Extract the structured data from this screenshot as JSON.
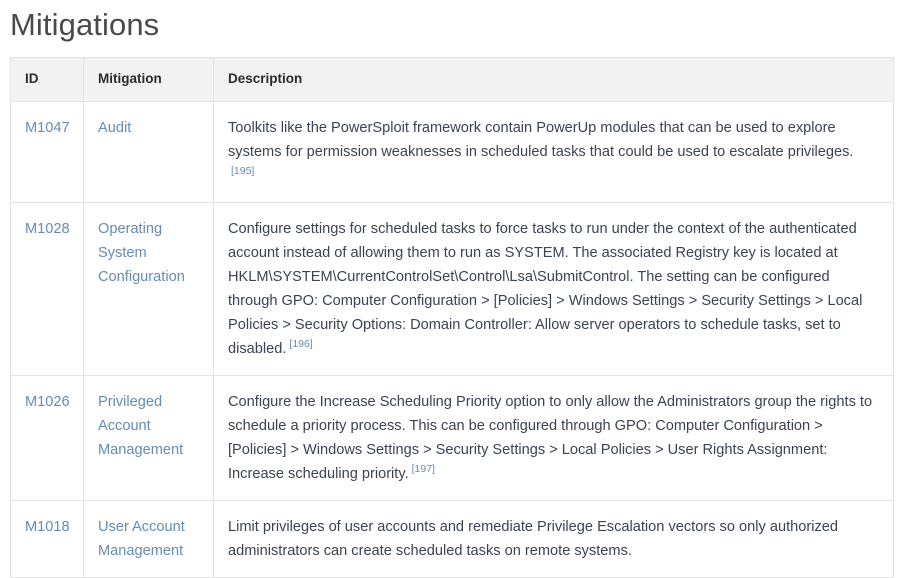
{
  "page": {
    "title": "Mitigations"
  },
  "table": {
    "columns": [
      {
        "key": "id",
        "label": "ID"
      },
      {
        "key": "mitigation",
        "label": "Mitigation"
      },
      {
        "key": "description",
        "label": "Description"
      }
    ],
    "rows": [
      {
        "id": "M1047",
        "mitigation": "Audit",
        "description": "Toolkits like the PowerSploit framework contain PowerUp modules that can be used to explore systems for permission weaknesses in scheduled tasks that could be used to escalate privileges.",
        "reference": "[195]"
      },
      {
        "id": "M1028",
        "mitigation": "Operating System Configuration",
        "description": "Configure settings for scheduled tasks to force tasks to run under the context of the authenticated account instead of allowing them to run as SYSTEM. The associated Registry key is located at HKLM\\SYSTEM\\CurrentControlSet\\Control\\Lsa\\SubmitControl. The setting can be configured through GPO: Computer Configuration > [Policies] > Windows Settings > Security Settings > Local Policies > Security Options: Domain Controller: Allow server operators to schedule tasks, set to disabled.",
        "reference": "[196]"
      },
      {
        "id": "M1026",
        "mitigation": "Privileged Account Management",
        "description": "Configure the Increase Scheduling Priority option to only allow the Administrators group the rights to schedule a priority process. This can be configured through GPO: Computer Configuration > [Policies] > Windows Settings > Security Settings > Local Policies > User Rights Assignment: Increase scheduling priority.",
        "reference": "[197]"
      },
      {
        "id": "M1018",
        "mitigation": "User Account Management",
        "description": "Limit privileges of user accounts and remediate Privilege Escalation vectors so only authorized administrators can create scheduled tasks on remote systems.",
        "reference": ""
      }
    ]
  },
  "colors": {
    "link": "#668cb3",
    "header_background": "#f2f2f2",
    "border": "#e3e3e3",
    "body_text": "#3b4350",
    "title_text": "#4a4a4a"
  }
}
